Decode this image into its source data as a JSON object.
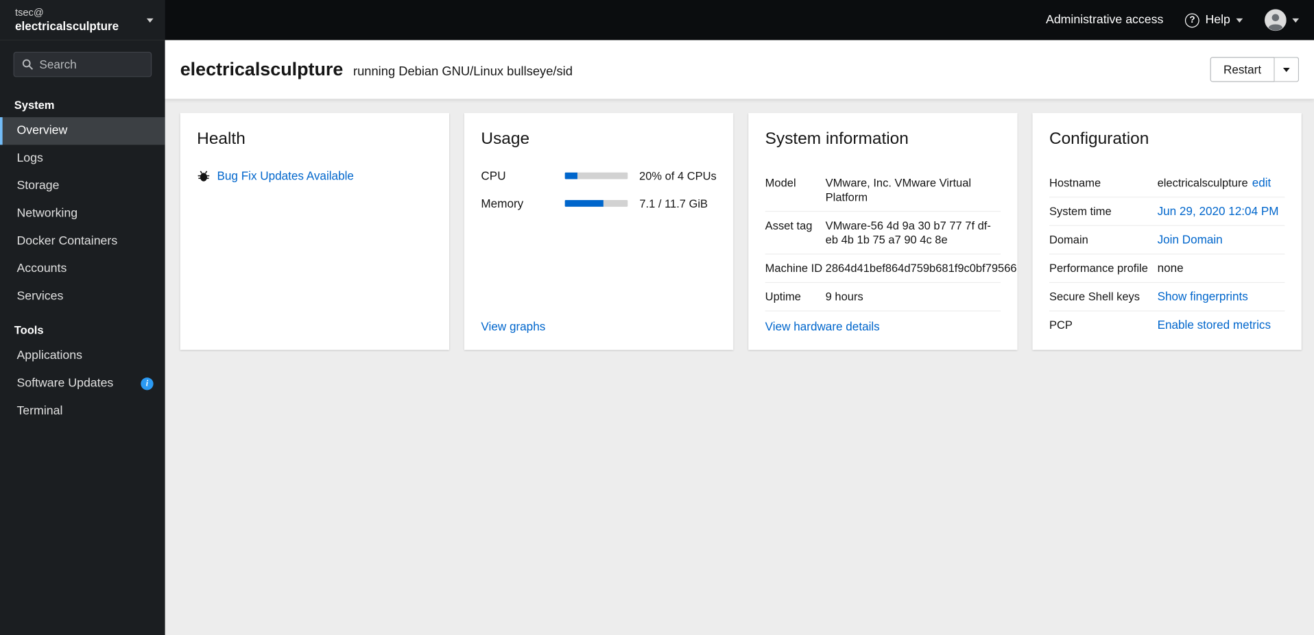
{
  "colors": {
    "link": "#0066cc",
    "progress_fill": "#0066cc",
    "nav_active_accent": "#73bcf7",
    "info_badge": "#2b9af3"
  },
  "icons": {
    "help_glyph": "?",
    "info_glyph": "i"
  },
  "topbar": {
    "admin_access_label": "Administrative access",
    "help_label": "Help"
  },
  "sidebar": {
    "host_switcher": {
      "user": "tsec@",
      "host": "electricalsculpture"
    },
    "search": {
      "placeholder": "Search"
    },
    "sections": [
      {
        "label": "System",
        "items": [
          {
            "label": "Overview",
            "active": true
          },
          {
            "label": "Logs"
          },
          {
            "label": "Storage"
          },
          {
            "label": "Networking"
          },
          {
            "label": "Docker Containers"
          },
          {
            "label": "Accounts"
          },
          {
            "label": "Services"
          }
        ]
      },
      {
        "label": "Tools",
        "items": [
          {
            "label": "Applications"
          },
          {
            "label": "Software Updates",
            "badge": "info"
          },
          {
            "label": "Terminal"
          }
        ]
      }
    ]
  },
  "header": {
    "hostname": "electricalsculpture",
    "os_text": "running Debian GNU/Linux bullseye/sid",
    "restart_label": "Restart"
  },
  "cards": {
    "health": {
      "title": "Health",
      "updates_link": "Bug Fix Updates Available"
    },
    "usage": {
      "title": "Usage",
      "rows": [
        {
          "label": "CPU",
          "percent": 20,
          "value": "20% of 4 CPUs"
        },
        {
          "label": "Memory",
          "percent": 61,
          "value": "7.1 / 11.7 GiB"
        }
      ],
      "link": "View graphs"
    },
    "system_info": {
      "title": "System information",
      "rows": [
        {
          "label": "Model",
          "value": "VMware, Inc. VMware Virtual Platform"
        },
        {
          "label": "Asset tag",
          "value": "VMware-56 4d 9a 30 b7 77 7f df-eb 4b 1b 75 a7 90 4c 8e"
        },
        {
          "label": "Machine ID",
          "value": "2864d41bef864d759b681f9c0bf79566"
        },
        {
          "label": "Uptime",
          "value": "9 hours"
        }
      ],
      "link": "View hardware details"
    },
    "configuration": {
      "title": "Configuration",
      "rows": [
        {
          "label": "Hostname",
          "value": "electricalsculpture",
          "action": "edit"
        },
        {
          "label": "System time",
          "link": "Jun 29, 2020 12:04 PM"
        },
        {
          "label": "Domain",
          "link": "Join Domain"
        },
        {
          "label": "Performance profile",
          "value": "none"
        },
        {
          "label": "Secure Shell keys",
          "link": "Show fingerprints"
        },
        {
          "label": "PCP",
          "link": "Enable stored metrics"
        }
      ]
    }
  }
}
